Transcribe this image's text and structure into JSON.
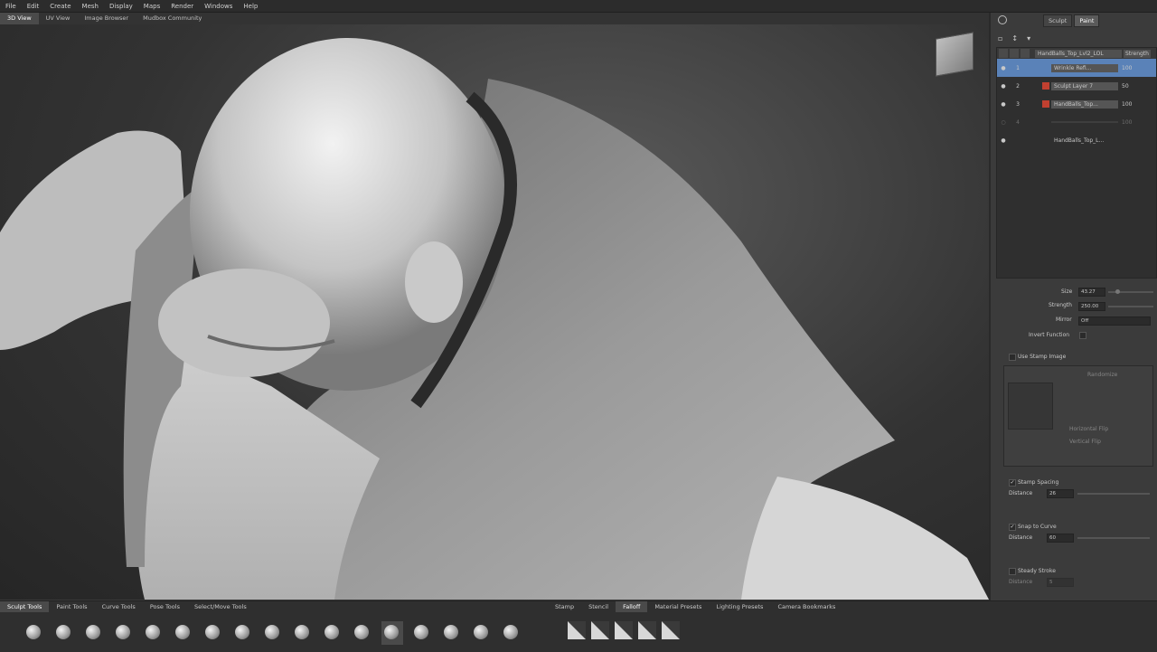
{
  "menu": [
    "File",
    "Edit",
    "Create",
    "Mesh",
    "Display",
    "Maps",
    "Render",
    "Windows",
    "Help"
  ],
  "view_tabs": [
    "3D View",
    "UV View",
    "Image Browser",
    "Mudbox Community"
  ],
  "right_panel": {
    "tabs": [
      "Sculpt",
      "Paint"
    ],
    "layer_header": {
      "name": "HandBalls_Top_Lvl2_LOL",
      "strength": "Strength"
    },
    "layers": [
      {
        "num": "1",
        "name": "Wrinkle Refi...",
        "value": "100",
        "selected": true
      },
      {
        "num": "2",
        "name": "Sculpt Layer 7",
        "value": "50"
      },
      {
        "num": "3",
        "name": "HandBalls_Top...",
        "value": "100"
      },
      {
        "num": "4",
        "name": "",
        "value": "100"
      },
      {
        "num": "",
        "name": "HandBalls_Top_L...",
        "value": ""
      }
    ],
    "props": {
      "size_label": "Size",
      "size_value": "43.27",
      "strength_label": "Strength",
      "strength_value": "250.00",
      "mirror_label": "Mirror",
      "mirror_value": "Off",
      "invert_label": "Invert Function",
      "stamp_image_label": "Use Stamp Image",
      "randomize_label": "Randomize",
      "horizontal_flip": "Horizontal Flip",
      "vertical_flip": "Vertical Flip",
      "stamp_spacing_label": "Stamp Spacing",
      "distance_label": "Distance",
      "distance_value": "26",
      "snap_label": "Snap to Curve",
      "snap_distance_label": "Distance",
      "snap_distance_value": "60",
      "steady_label": "Steady Stroke",
      "steady_distance_label": "Distance",
      "steady_distance_value": "5"
    }
  },
  "bottom": {
    "tabs": [
      "Sculpt Tools",
      "Paint Tools",
      "Curve Tools",
      "Pose Tools",
      "Select/Move Tools"
    ],
    "right_tabs": [
      "Stamp",
      "Stencil",
      "Falloff",
      "Material Presets",
      "Lighting Presets",
      "Camera Bookmarks"
    ]
  },
  "icons": [
    "view-cube-icon",
    "sculpt-brush-icon",
    "falloff-stamp-icon"
  ]
}
